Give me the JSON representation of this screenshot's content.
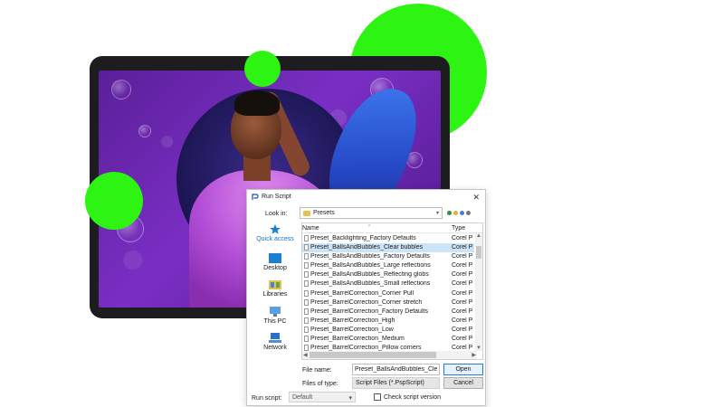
{
  "dialog": {
    "title": "Run Script",
    "close_glyph": "✕",
    "lookin_label": "Look in:",
    "lookin_value": "Presets",
    "lookin_arrow": "▾",
    "places": [
      {
        "label": "Quick access",
        "icon": "star-icon"
      },
      {
        "label": "Desktop",
        "icon": "desktop-icon"
      },
      {
        "label": "Libraries",
        "icon": "libraries-icon"
      },
      {
        "label": "This PC",
        "icon": "computer-icon"
      },
      {
        "label": "Network",
        "icon": "network-icon"
      }
    ],
    "columns": {
      "name": "Name",
      "type": "Type"
    },
    "files": [
      {
        "name": "Preset_Backlighting_Factory Defaults",
        "type": "Corel PS"
      },
      {
        "name": "Preset_BallsAndBubbles_Clear bubbles",
        "type": "Corel PS"
      },
      {
        "name": "Preset_BallsAndBubbles_Factory Defaults",
        "type": "Corel PS"
      },
      {
        "name": "Preset_BallsAndBubbles_Large reflections",
        "type": "Corel PS"
      },
      {
        "name": "Preset_BallsAndBubbles_Reflecting globs",
        "type": "Corel PS"
      },
      {
        "name": "Preset_BallsAndBubbles_Small reflections",
        "type": "Corel PS"
      },
      {
        "name": "Preset_BarrelCorrection_Corner Pull",
        "type": "Corel PS"
      },
      {
        "name": "Preset_BarrelCorrection_Corner stretch",
        "type": "Corel PS"
      },
      {
        "name": "Preset_BarrelCorrection_Factory Defaults",
        "type": "Corel PS"
      },
      {
        "name": "Preset_BarrelCorrection_High",
        "type": "Corel PS"
      },
      {
        "name": "Preset_BarrelCorrection_Low",
        "type": "Corel PS"
      },
      {
        "name": "Preset_BarrelCorrection_Medium",
        "type": "Corel PS"
      },
      {
        "name": "Preset_BarrelCorrection_Pillow corners",
        "type": "Corel PS"
      }
    ],
    "selected_index": 1,
    "file_name_label": "File name:",
    "file_name_value": "Preset_BallsAndBubbles_Clear bubbles",
    "files_of_type_label": "Files of type:",
    "files_of_type_value": "Script Files (*.PspScript)",
    "open_label": "Open",
    "cancel_label": "Cancel",
    "run_script_label": "Run script:",
    "run_script_value": "Default",
    "check_label": "Check script version",
    "check_checked": false
  },
  "colors": {
    "accent_green": "#2df413",
    "screen_purple": "#7a2fc4",
    "selection_blue": "#cce4f7",
    "link_blue": "#1b6fc6"
  }
}
